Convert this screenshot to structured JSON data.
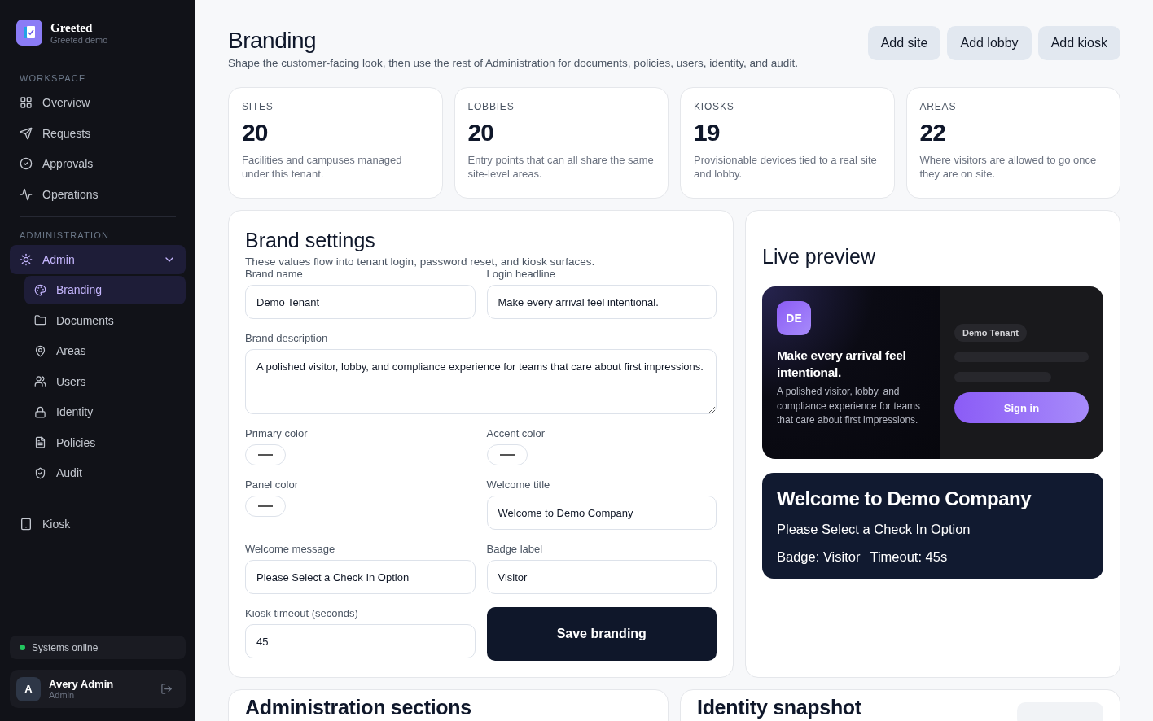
{
  "sidebar": {
    "brand": {
      "name": "Greeted",
      "subtitle": "Greeted demo"
    },
    "sections": [
      {
        "heading": "WORKSPACE",
        "items": [
          {
            "label": "Overview",
            "selected": false
          },
          {
            "label": "Requests",
            "selected": false
          },
          {
            "label": "Approvals",
            "selected": false
          },
          {
            "label": "Operations",
            "selected": false
          }
        ]
      },
      {
        "heading": "ADMINISTRATION",
        "items": [
          {
            "label": "Admin",
            "selected": true,
            "expanded": true,
            "children": [
              {
                "label": "Branding",
                "selected": true
              },
              {
                "label": "Documents",
                "selected": false
              },
              {
                "label": "Areas",
                "selected": false
              },
              {
                "label": "Users",
                "selected": false
              },
              {
                "label": "Identity",
                "selected": false
              },
              {
                "label": "Policies",
                "selected": false
              },
              {
                "label": "Audit",
                "selected": false
              }
            ]
          }
        ]
      },
      {
        "items": [
          {
            "label": "Kiosk",
            "selected": false
          }
        ]
      }
    ],
    "status": {
      "label": "Systems online",
      "color": "#22c55e"
    },
    "user": {
      "initial": "A",
      "name": "Avery Admin",
      "role": "Admin"
    }
  },
  "header": {
    "title": "Branding",
    "subtitle": "Shape the customer-facing look, then use the rest of Administration for documents, policies, users, identity, and audit.",
    "actions": [
      "Add site",
      "Add lobby",
      "Add kiosk"
    ]
  },
  "stats": [
    {
      "label": "SITES",
      "value": "20",
      "description": "Facilities and campuses managed under this tenant."
    },
    {
      "label": "LOBBIES",
      "value": "20",
      "description": "Entry points that can all share the same site-level areas."
    },
    {
      "label": "KIOSKS",
      "value": "19",
      "description": "Provisionable devices tied to a real site and lobby."
    },
    {
      "label": "AREAS",
      "value": "22",
      "description": "Where visitors are allowed to go once they are on site."
    }
  ],
  "brand_settings": {
    "title": "Brand settings",
    "description": "These values flow into tenant login, password reset, and kiosk surfaces.",
    "fields": [
      {
        "kind": "text",
        "label": "Brand name",
        "value": "Demo Tenant"
      },
      {
        "kind": "text",
        "label": "Login headline",
        "value": "Make every arrival feel intentional."
      },
      {
        "kind": "textarea",
        "label": "Brand description",
        "value": "A polished visitor, lobby, and compliance experience for teams that care about first impressions."
      },
      {
        "kind": "color",
        "label": "Primary color"
      },
      {
        "kind": "color",
        "label": "Accent color"
      },
      {
        "kind": "color",
        "label": "Panel color"
      },
      {
        "kind": "text",
        "label": "Welcome title",
        "value": "Welcome to Demo Company"
      },
      {
        "kind": "text",
        "label": "Welcome message",
        "value": "Please Select a Check In Option"
      },
      {
        "kind": "text",
        "label": "Badge label",
        "value": "Visitor"
      },
      {
        "kind": "text",
        "label": "Kiosk timeout (seconds)",
        "value": "45"
      },
      {
        "kind": "button",
        "label": "Save branding"
      }
    ]
  },
  "live_preview": {
    "title": "Live preview",
    "login": {
      "monogram": "DE",
      "headline": "Make every arrival feel intentional.",
      "body": "A polished visitor, lobby, and compliance experience for teams that care about first impressions.",
      "tenant": "Demo Tenant",
      "button": "Sign in"
    },
    "kiosk": {
      "title": "Welcome to Demo Company",
      "message": "Please Select a Check In Option",
      "badge": "Badge: Visitor",
      "timeout": "Timeout: 45s"
    }
  },
  "bottom_cards": [
    {
      "title": "Administration sections"
    },
    {
      "title": "Identity snapshot",
      "has_action": true
    }
  ]
}
